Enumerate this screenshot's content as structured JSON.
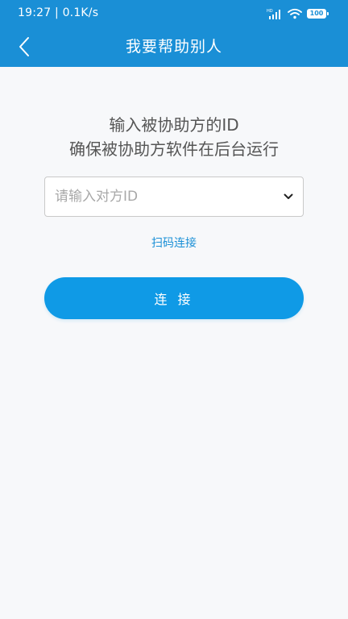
{
  "status_bar": {
    "time_speed": "19:27 | 0.1K/s",
    "signal_label": "HD",
    "battery": "100"
  },
  "nav": {
    "title": "我要帮助别人"
  },
  "instructions": {
    "line1": "输入被协助方的ID",
    "line2": "确保被协助方软件在后台运行"
  },
  "id_input": {
    "placeholder": "请输入对方ID",
    "value": ""
  },
  "scan_link": "扫码连接",
  "connect_button": "连 接",
  "colors": {
    "header": "#1a8fd6",
    "accent": "#0f9ae6",
    "background": "#f7f8fa"
  },
  "icons": {
    "back": "chevron-left-icon",
    "dropdown": "chevron-down-icon",
    "signal": "cell-signal-icon",
    "wifi": "wifi-icon",
    "battery": "battery-icon"
  }
}
